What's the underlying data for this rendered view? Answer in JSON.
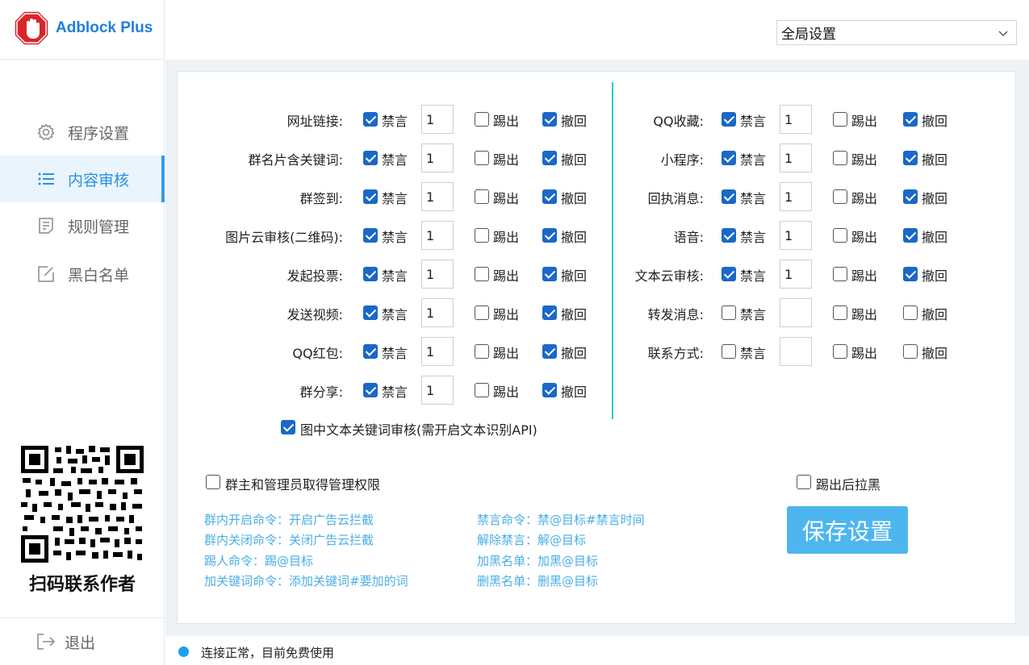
{
  "app": {
    "name": "Adblock Plus"
  },
  "sidebar": {
    "items": [
      {
        "label": "程序设置",
        "icon": "gear-icon"
      },
      {
        "label": "内容审核",
        "icon": "list-icon"
      },
      {
        "label": "规则管理",
        "icon": "document-icon"
      },
      {
        "label": "黑白名单",
        "icon": "edit-icon"
      }
    ],
    "qr_caption": "扫码联系作者",
    "logout": "退出"
  },
  "topbar": {
    "scope_select": "全局设置"
  },
  "rules": {
    "left": [
      {
        "label": "网址链接:",
        "mute": "禁言",
        "mute_checked": true,
        "duration": "1",
        "kick": "踢出",
        "kick_checked": false,
        "recall": "撤回",
        "recall_checked": true
      },
      {
        "label": "群名片含关键词:",
        "mute": "禁言",
        "mute_checked": true,
        "duration": "1",
        "kick": "踢出",
        "kick_checked": false,
        "recall": "撤回",
        "recall_checked": true
      },
      {
        "label": "群签到:",
        "mute": "禁言",
        "mute_checked": true,
        "duration": "1",
        "kick": "踢出",
        "kick_checked": false,
        "recall": "撤回",
        "recall_checked": true
      },
      {
        "label": "图片云审核(二维码):",
        "mute": "禁言",
        "mute_checked": true,
        "duration": "1",
        "kick": "踢出",
        "kick_checked": false,
        "recall": "撤回",
        "recall_checked": true
      },
      {
        "label": "发起投票:",
        "mute": "禁言",
        "mute_checked": true,
        "duration": "1",
        "kick": "踢出",
        "kick_checked": false,
        "recall": "撤回",
        "recall_checked": true
      },
      {
        "label": "发送视频:",
        "mute": "禁言",
        "mute_checked": true,
        "duration": "1",
        "kick": "踢出",
        "kick_checked": false,
        "recall": "撤回",
        "recall_checked": true
      },
      {
        "label": "QQ红包:",
        "mute": "禁言",
        "mute_checked": true,
        "duration": "1",
        "kick": "踢出",
        "kick_checked": false,
        "recall": "撤回",
        "recall_checked": true
      },
      {
        "label": "群分享:",
        "mute": "禁言",
        "mute_checked": true,
        "duration": "1",
        "kick": "踢出",
        "kick_checked": false,
        "recall": "撤回",
        "recall_checked": true
      }
    ],
    "right": [
      {
        "label": "QQ收藏:",
        "mute": "禁言",
        "mute_checked": true,
        "duration": "1",
        "kick": "踢出",
        "kick_checked": false,
        "recall": "撤回",
        "recall_checked": true
      },
      {
        "label": "小程序:",
        "mute": "禁言",
        "mute_checked": true,
        "duration": "1",
        "kick": "踢出",
        "kick_checked": false,
        "recall": "撤回",
        "recall_checked": true
      },
      {
        "label": "回执消息:",
        "mute": "禁言",
        "mute_checked": true,
        "duration": "1",
        "kick": "踢出",
        "kick_checked": false,
        "recall": "撤回",
        "recall_checked": true
      },
      {
        "label": "语音:",
        "mute": "禁言",
        "mute_checked": true,
        "duration": "1",
        "kick": "踢出",
        "kick_checked": false,
        "recall": "撤回",
        "recall_checked": true
      },
      {
        "label": "文本云审核:",
        "mute": "禁言",
        "mute_checked": true,
        "duration": "1",
        "kick": "踢出",
        "kick_checked": false,
        "recall": "撤回",
        "recall_checked": true
      },
      {
        "label": "转发消息:",
        "mute": "禁言",
        "mute_checked": false,
        "duration": "",
        "kick": "踢出",
        "kick_checked": false,
        "recall": "撤回",
        "recall_checked": false
      },
      {
        "label": "联系方式:",
        "mute": "禁言",
        "mute_checked": false,
        "duration": "",
        "kick": "踢出",
        "kick_checked": false,
        "recall": "撤回",
        "recall_checked": false
      }
    ]
  },
  "options": {
    "ocr_keyword": {
      "label": "图中文本关键词审核(需开启文本识别API)",
      "checked": true
    },
    "admin_rights": {
      "label": "群主和管理员取得管理权限",
      "checked": false
    },
    "blacklist_after_kick": {
      "label": "踢出后拉黑",
      "checked": false
    }
  },
  "commands": {
    "left": [
      "群内开启命令：开启广告云拦截",
      "群内关闭命令：关闭广告云拦截",
      "踢人命令：踢@目标",
      "加关键词命令：添加关键词#要加的词"
    ],
    "right": [
      "禁言命令：禁@目标#禁言时间",
      "解除禁言：解@目标",
      "加黑名单：加黑@目标",
      "删黑名单：删黑@目标"
    ]
  },
  "save_button": "保存设置",
  "status": {
    "text": "连接正常，目前免费使用"
  },
  "colors": {
    "accent": "#2d9bf0",
    "checkbox": "#1a68c9",
    "command_text": "#4aaee8",
    "divider": "#2fc5cf",
    "save_button": "#4db6ef"
  }
}
